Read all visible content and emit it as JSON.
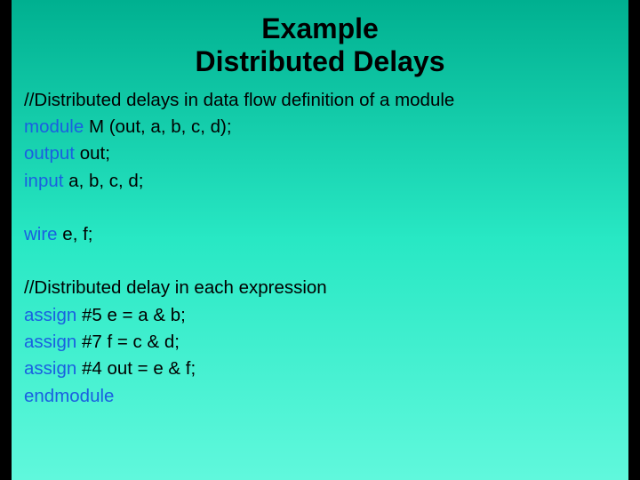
{
  "title": {
    "line1": "Example",
    "line2": "Distributed Delays"
  },
  "code": {
    "l1": "//Distributed delays in data flow definition of a module",
    "l2kw": "module",
    "l2rest": " M (out, a, b, c, d);",
    "l3kw": "output",
    "l3rest": " out;",
    "l4kw": "input",
    "l4rest": " a, b, c, d;",
    "l5kw": "wire",
    "l5rest": " e, f;",
    "l6": "//Distributed delay in each expression",
    "l7kw": "assign",
    "l7rest": " #5 e = a & b;",
    "l8kw": "assign",
    "l8rest": " #7 f = c & d;",
    "l9kw": "assign",
    "l9rest": " #4 out = e & f;",
    "l10kw": "endmodule"
  }
}
